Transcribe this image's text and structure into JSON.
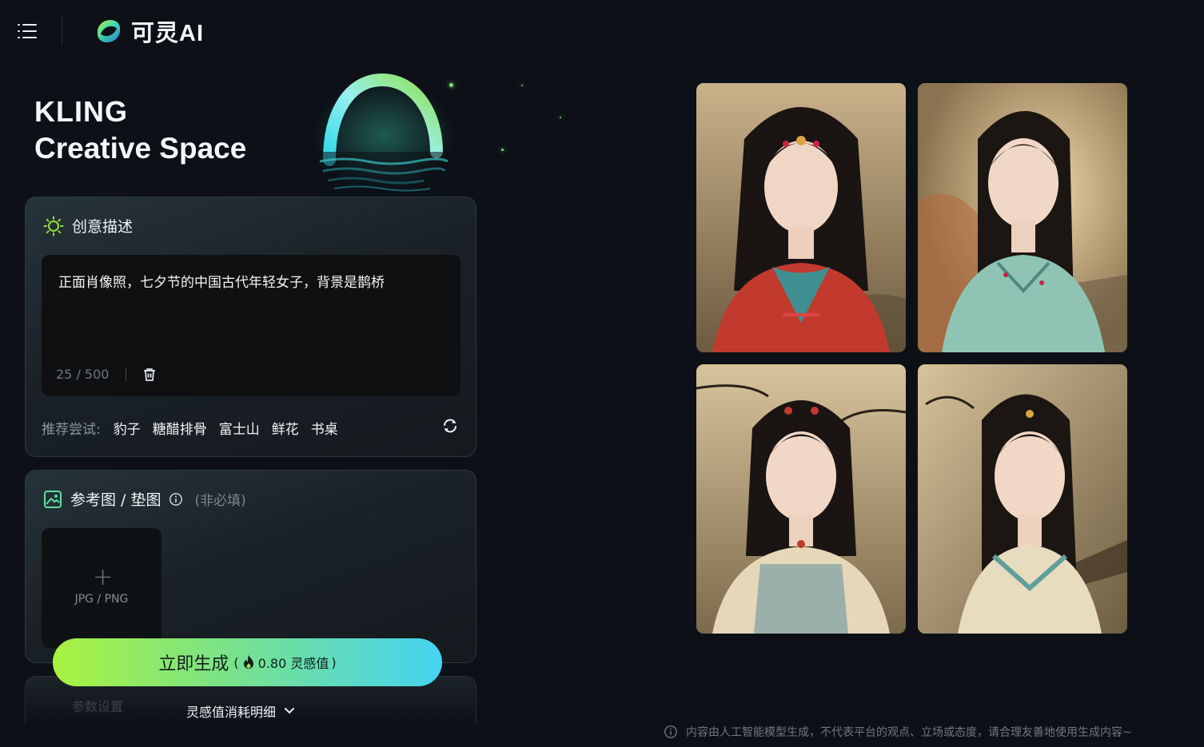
{
  "header": {
    "brand_name": "可灵AI",
    "menu_icon": "menu-icon"
  },
  "hero": {
    "line1": "KLING",
    "line2": "Creative Space"
  },
  "prompt_panel": {
    "title": "创意描述",
    "prompt_text": "正面肖像照，七夕节的中国古代年轻女子，背景是鹊桥",
    "counter": "25 / 500",
    "suggest_label": "推荐尝试:",
    "suggestions": [
      "豹子",
      "糖醋排骨",
      "富士山",
      "鲜花",
      "书桌"
    ]
  },
  "reference_panel": {
    "title": "参考图 / 垫图",
    "optional": "(非必填)",
    "upload_formats": "JPG / PNG",
    "upload_plus": "+"
  },
  "settings_panel": {
    "title": "参数设置"
  },
  "generate": {
    "label": "立即生成",
    "cost_open": "(",
    "cost_value": "0.80 灵感值",
    "cost_close": ")",
    "consumption_detail": "灵感值消耗明细"
  },
  "results": {
    "images": [
      {
        "name": "result-image-1",
        "palette": "red-teal"
      },
      {
        "name": "result-image-2",
        "palette": "moon-teal"
      },
      {
        "name": "result-image-3",
        "palette": "cream-blue"
      },
      {
        "name": "result-image-4",
        "palette": "cream-teal"
      }
    ]
  },
  "disclaimer": "内容由人工智能模型生成，不代表平台的观点、立场或态度，请合理友善地使用生成内容~",
  "colors": {
    "background": "#0d1117",
    "accent_green": "#a9f23f",
    "accent_cyan": "#44d3f2"
  }
}
